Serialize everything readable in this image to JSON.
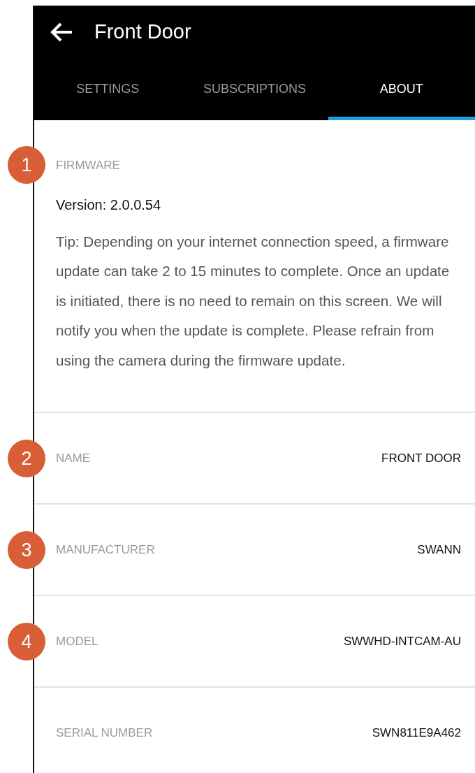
{
  "header": {
    "title": "Front Door"
  },
  "tabs": [
    {
      "label": "SETTINGS",
      "selected": false
    },
    {
      "label": "SUBSCRIPTIONS",
      "selected": false
    },
    {
      "label": "ABOUT",
      "selected": true
    }
  ],
  "firmware": {
    "callout": "1",
    "label": "FIRMWARE",
    "version": "Version: 2.0.0.54",
    "tip": "Tip: Depending on your internet connection speed, a firmware update can take 2 to 15 minutes to complete. Once an update is initiated, there is no need to remain on this screen. We will notify you when the update is complete. Please refrain from using the camera during the firmware update."
  },
  "rows": [
    {
      "callout": "2",
      "label": "NAME",
      "value": "FRONT DOOR"
    },
    {
      "callout": "3",
      "label": "MANUFACTURER",
      "value": "SWANN"
    },
    {
      "callout": "4",
      "label": "MODEL",
      "value": "SWWHD-INTCAM-AU"
    },
    {
      "label": "SERIAL NUMBER",
      "value": "SWN811E9A462"
    }
  ]
}
